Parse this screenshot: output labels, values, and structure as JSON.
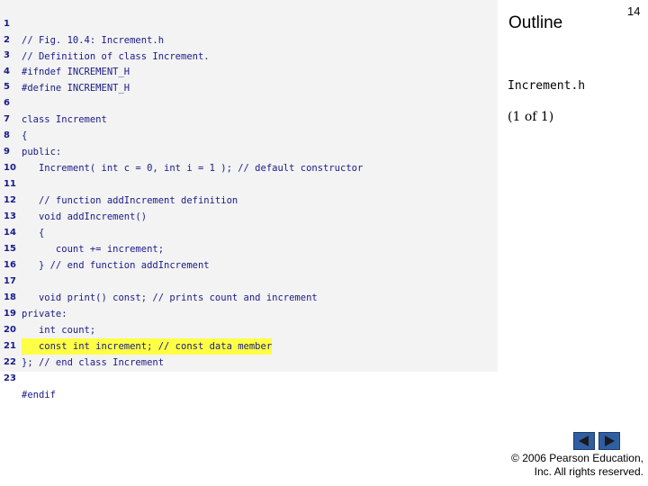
{
  "slide": {
    "outline_label": "Outline",
    "page_number": "14",
    "file_name": "Increment.h",
    "page_count": "(1 of 1)"
  },
  "code": {
    "highlight_line": 20,
    "highlight_color": "#ffff44",
    "text_color": "#1a1a8a",
    "lines": [
      {
        "num": "1",
        "text": "// Fig. 10.4: Increment.h"
      },
      {
        "num": "2",
        "text": "// Definition of class Increment."
      },
      {
        "num": "3",
        "text": "#ifndef INCREMENT_H"
      },
      {
        "num": "4",
        "text": "#define INCREMENT_H"
      },
      {
        "num": "5",
        "text": ""
      },
      {
        "num": "6",
        "text": "class Increment"
      },
      {
        "num": "7",
        "text": "{"
      },
      {
        "num": "8",
        "text": "public:"
      },
      {
        "num": "9",
        "text": "   Increment( int c = 0, int i = 1 ); // default constructor"
      },
      {
        "num": "10",
        "text": ""
      },
      {
        "num": "11",
        "text": "   // function addIncrement definition"
      },
      {
        "num": "12",
        "text": "   void addIncrement()"
      },
      {
        "num": "13",
        "text": "   {"
      },
      {
        "num": "14",
        "text": "      count += increment;"
      },
      {
        "num": "15",
        "text": "   } // end function addIncrement"
      },
      {
        "num": "16",
        "text": ""
      },
      {
        "num": "17",
        "text": "   void print() const; // prints count and increment"
      },
      {
        "num": "18",
        "text": "private:"
      },
      {
        "num": "19",
        "text": "   int count;"
      },
      {
        "num": "20",
        "text": "   const int increment; // const data member"
      },
      {
        "num": "21",
        "text": "}; // end class Increment"
      },
      {
        "num": "22",
        "text": ""
      },
      {
        "num": "23",
        "text": "#endif"
      }
    ]
  },
  "navigation": {
    "prev_icon": "triangle-left-icon",
    "next_icon": "triangle-right-icon",
    "button_color": "#2f5fa2"
  },
  "footer": {
    "copyright_line1": "© 2006 Pearson Education,",
    "copyright_line2": "Inc.  All rights reserved."
  }
}
